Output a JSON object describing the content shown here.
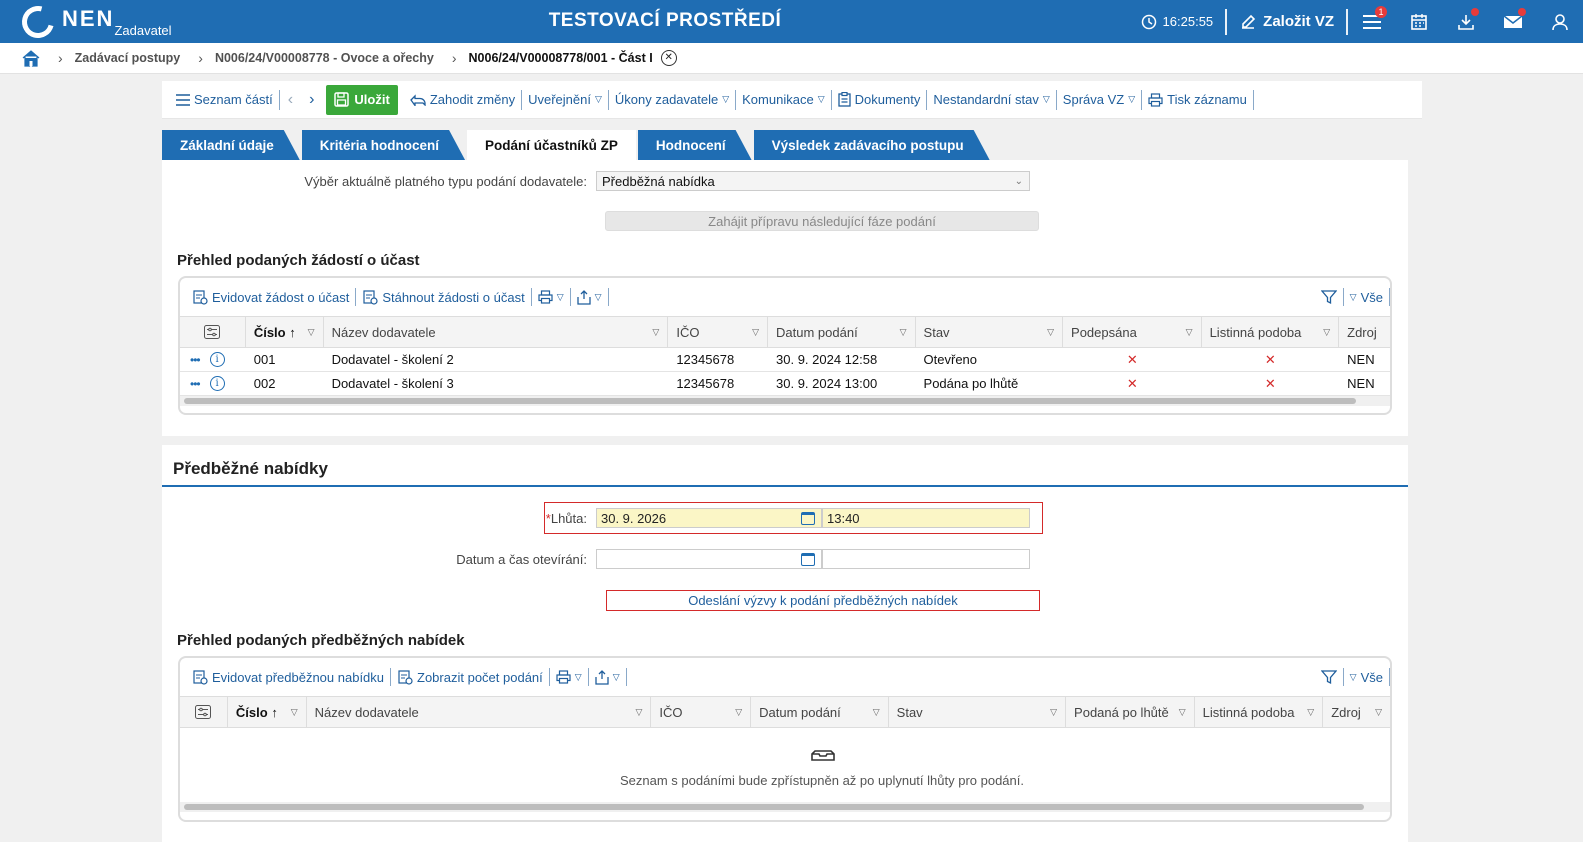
{
  "header": {
    "logo_text": "NEN",
    "logo_sub": "Zadavatel",
    "env_title": "TESTOVACÍ PROSTŘEDÍ",
    "time": "16:25:55",
    "create_label": "Založit VZ",
    "menu_badge": "1",
    "icons": [
      "clock-icon",
      "edit-icon",
      "menu-icon",
      "calendar-icon",
      "download-icon",
      "mail-icon",
      "user-icon"
    ]
  },
  "breadcrumb": {
    "items": [
      "Zadávací postupy",
      "N006/24/V00008778 - Ovoce a ořechy",
      "N006/24/V00008778/001 - Část I"
    ]
  },
  "toolbar": {
    "list_parts": "Seznam částí",
    "save": "Uložit",
    "discard": "Zahodit změny",
    "publish": "Uveřejnění",
    "actions": "Úkony zadavatele",
    "communication": "Komunikace",
    "documents": "Dokumenty",
    "nonstandard": "Nestandardní stav",
    "admin": "Správa VZ",
    "print": "Tisk záznamu"
  },
  "tabs": [
    "Základní údaje",
    "Kritéria hodnocení",
    "Podání účastníků ZP",
    "Hodnocení",
    "Výsledek zadávacího postupu"
  ],
  "active_tab": 2,
  "submission_type": {
    "label": "Výběr aktuálně platného typu podání dodavatele:",
    "value": "Předběžná nabídka",
    "next_phase_button": "Zahájit přípravu následující fáze podání"
  },
  "requests": {
    "title": "Přehled podaných žádostí o účast",
    "toolbar": {
      "register": "Evidovat žádost o účast",
      "download": "Stáhnout žádosti o účast",
      "all": "Vše"
    },
    "columns": [
      "Číslo",
      "Název dodavatele",
      "IČO",
      "Datum podání",
      "Stav",
      "Podepsána",
      "Listinná podoba",
      "Zdroj"
    ],
    "rows": [
      {
        "number": "001",
        "supplier": "Dodavatel - školení 2",
        "ico": "12345678",
        "date": "30. 9. 2024 12:58",
        "state": "Otevřeno",
        "signed": "✕",
        "paper": "✕",
        "source": "NEN"
      },
      {
        "number": "002",
        "supplier": "Dodavatel - školení 3",
        "ico": "12345678",
        "date": "30. 9. 2024 13:00",
        "state": "Podána po lhůtě",
        "signed": "✕",
        "paper": "✕",
        "source": "NEN"
      }
    ]
  },
  "preliminary": {
    "title": "Předběžné nabídky",
    "deadline_label": "Lhůta:",
    "deadline_required_mark": "*",
    "deadline_date": "30. 9. 2026",
    "deadline_time": "13:40",
    "opening_label": "Datum a čas otevírání:",
    "opening_value": "",
    "send_invitation": "Odeslání výzvy k podání předběžných nabídek"
  },
  "offers": {
    "title": "Přehled podaných předběžných nabídek",
    "toolbar": {
      "register": "Evidovat předběžnou nabídku",
      "count": "Zobrazit počet podání",
      "all": "Vše"
    },
    "columns": [
      "Číslo",
      "Název dodavatele",
      "IČO",
      "Datum podání",
      "Stav",
      "Podaná po lhůtě",
      "Listinná podoba",
      "Zdroj"
    ],
    "empty_message": "Seznam s podáními bude zpřístupněn až po uplynutí lhůty pro podání."
  },
  "colors": {
    "primary": "#1f6db3",
    "save_green": "#3aa83a",
    "error_red": "#d42a2a",
    "required_bg": "#fbf6c6"
  }
}
